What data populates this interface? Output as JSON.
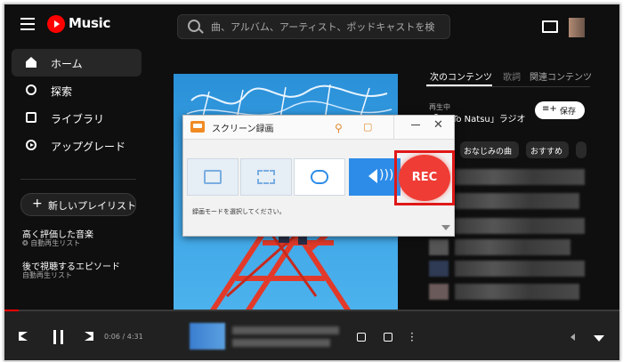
{
  "app": {
    "logo_text": "Music"
  },
  "search": {
    "placeholder": "曲、アルバム、アーティスト、ポッドキャストを検"
  },
  "sidebar": {
    "items": [
      {
        "label": "ホーム",
        "icon": "home-icon",
        "active": true
      },
      {
        "label": "探索",
        "icon": "compass-icon"
      },
      {
        "label": "ライブラリ",
        "icon": "library-icon"
      },
      {
        "label": "アップグレード",
        "icon": "upgrade-icon"
      }
    ],
    "new_playlist_label": "新しいプレイリスト",
    "playlists": [
      {
        "title": "高く評価した音楽",
        "subtitle": "自動再生リスト"
      },
      {
        "title": "後で視聴するエピソード",
        "subtitle": "自動再生リスト"
      }
    ]
  },
  "right_panel": {
    "tabs": [
      "次のコンテンツ",
      "歌詞",
      "関連コンテンツ"
    ],
    "now_playing_label": "再生中",
    "now_playing_title": "「Ao To Natsu」ラジオ",
    "save_label": "保存",
    "chips": [
      "おなじみの曲",
      "おすすめ"
    ]
  },
  "player": {
    "time": "0:06 / 4:31",
    "progress_fraction": 0.023
  },
  "recorder": {
    "title": "スクリーン録画",
    "rec_label": "REC",
    "hint": "録画モードを選択してください。",
    "modes": [
      "region-icon",
      "fullscreen-icon",
      "gamepad-icon",
      "audio-icon"
    ]
  },
  "colors": {
    "accent_red": "#ff0000",
    "rec_red": "#ef3c34",
    "mode_blue": "#2d8ce8"
  }
}
